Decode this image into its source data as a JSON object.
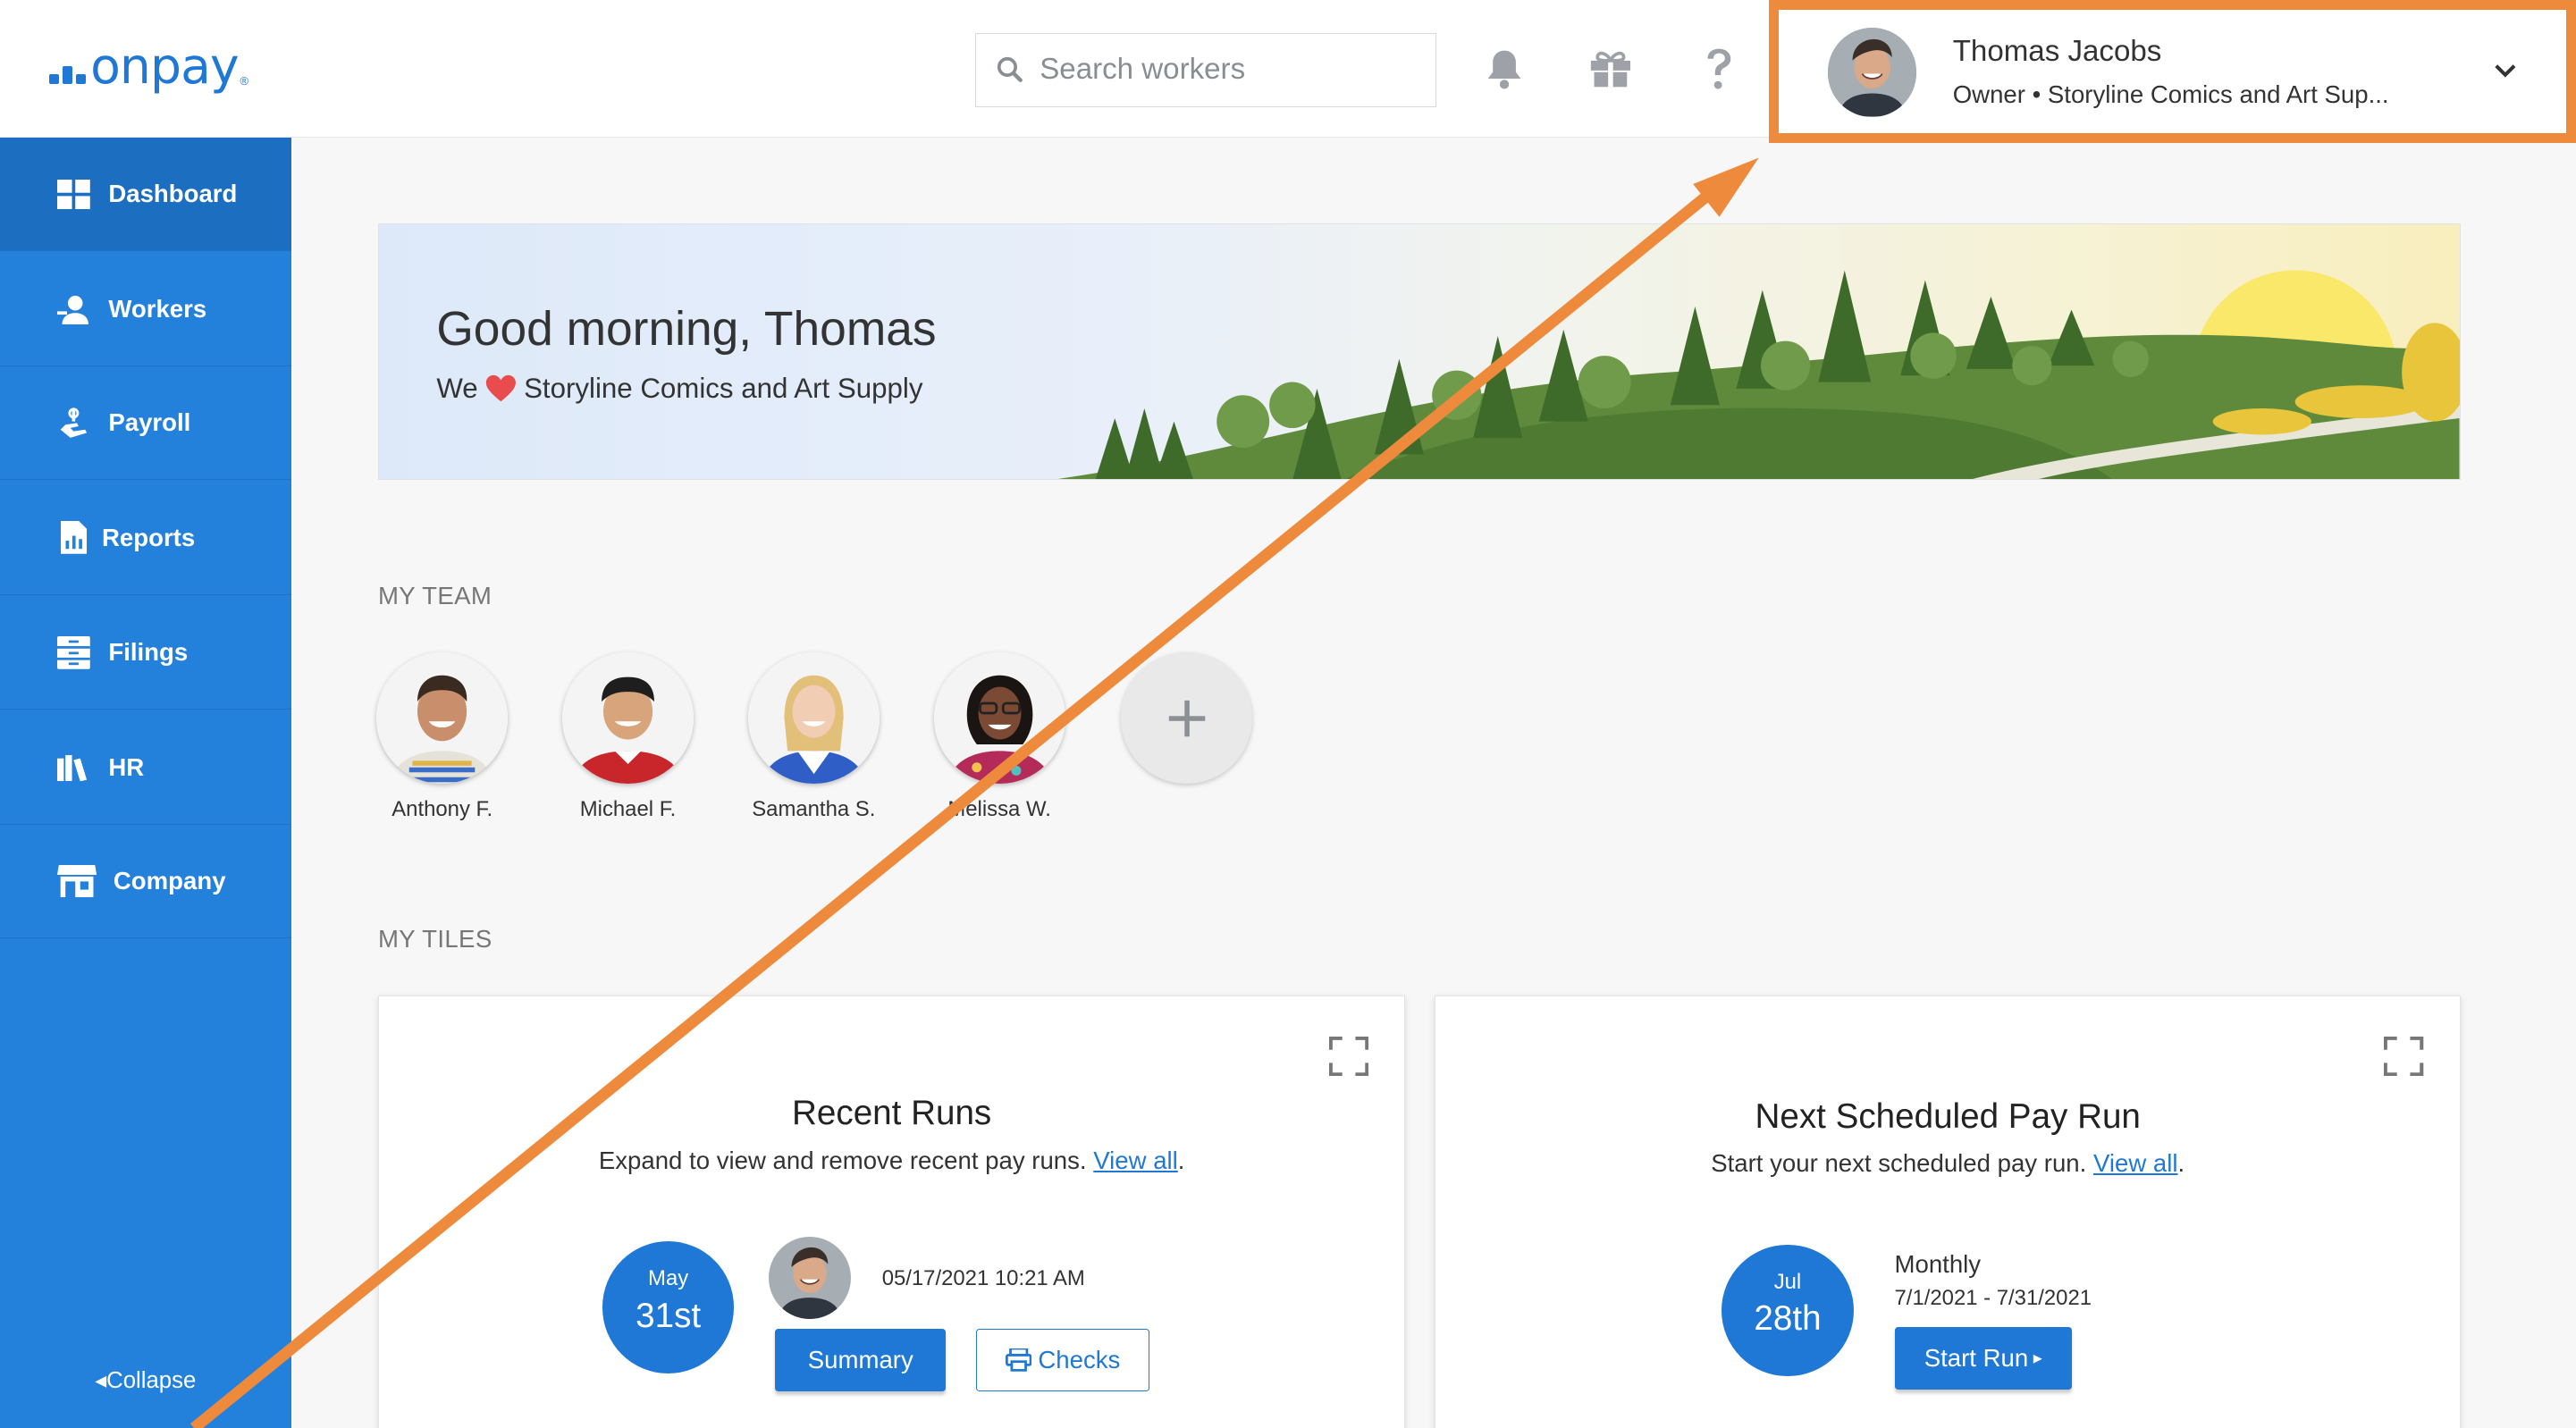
{
  "header": {
    "logo_text": "onpay",
    "logo_reg": "®",
    "search_placeholder": "Search workers",
    "icons": [
      "bell-icon",
      "gift-icon",
      "help-icon"
    ],
    "profile": {
      "name": "Thomas Jacobs",
      "role": "Owner • Storyline Comics and Art Sup..."
    }
  },
  "sidebar": {
    "items": [
      {
        "label": "Dashboard",
        "icon": "dashboard-icon"
      },
      {
        "label": "Workers",
        "icon": "workers-icon"
      },
      {
        "label": "Payroll",
        "icon": "payroll-icon"
      },
      {
        "label": "Reports",
        "icon": "reports-icon"
      },
      {
        "label": "Filings",
        "icon": "filings-icon"
      },
      {
        "label": "HR",
        "icon": "hr-icon"
      },
      {
        "label": "Company",
        "icon": "company-icon"
      }
    ],
    "collapse_label": "Collapse"
  },
  "banner": {
    "greeting": "Good morning, Thomas",
    "sub_prefix": "We",
    "sub_company": "Storyline Comics and Art Supply"
  },
  "team": {
    "label": "MY TEAM",
    "members": [
      {
        "name": "Anthony F."
      },
      {
        "name": "Michael F."
      },
      {
        "name": "Samantha S."
      },
      {
        "name": "Melissa W."
      }
    ]
  },
  "tiles": {
    "label": "MY TILES",
    "recent_runs": {
      "title": "Recent Runs",
      "desc": "Expand to view and remove recent pay runs.",
      "link": "View all",
      "month": "May",
      "day": "31st",
      "timestamp": "05/17/2021 10:21 AM",
      "summary_label": "Summary",
      "checks_label": "Checks"
    },
    "next_run": {
      "title": "Next Scheduled Pay Run",
      "desc": "Start your next scheduled pay run.",
      "link": "View all",
      "month": "Jul",
      "day": "28th",
      "frequency": "Monthly",
      "range": "7/1/2021 - 7/31/2021",
      "start_label": "Start Run"
    }
  },
  "colors": {
    "brand_blue": "#1f78d6",
    "sidebar_blue": "#2380db",
    "annotation_orange": "#ee8a3c"
  }
}
